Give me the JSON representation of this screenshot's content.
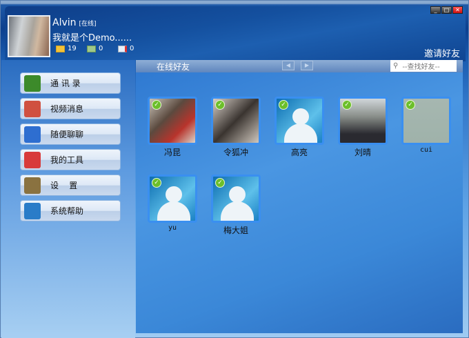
{
  "window": {
    "minimize": "_",
    "restore": "□",
    "close": "✕"
  },
  "profile": {
    "name": "Alvin",
    "status": "[在线]",
    "signature": "我就是个Demo......",
    "mail_count": "19",
    "note_count": "0",
    "message_count": "0"
  },
  "header": {
    "invite": "邀请好友"
  },
  "sidebar": {
    "items": [
      {
        "label": "通 讯 录",
        "icon": "contacts-icon",
        "color": "#3c8a2a"
      },
      {
        "label": "视频消息",
        "icon": "video-message-icon",
        "color": "#d05040"
      },
      {
        "label": "随便聊聊",
        "icon": "chat-icon",
        "color": "#2e6ed0"
      },
      {
        "label": "我的工具",
        "icon": "tools-icon",
        "color": "#d83a3a"
      },
      {
        "label": "设    置",
        "icon": "gear-icon",
        "color": "#8a7240"
      },
      {
        "label": "系统帮助",
        "icon": "help-icon",
        "color": "#2a7cc8"
      }
    ]
  },
  "main": {
    "title": "在线好友",
    "prev": "◀",
    "next": "▶",
    "search_placeholder": "--查找好友--",
    "friends": [
      {
        "name": "冯昆",
        "photo": "linear-gradient(135deg,#c7c2b8,#5b4a3f 40%,#b8342c 70%,#d9d4c9)"
      },
      {
        "name": "令狐冲",
        "photo": "linear-gradient(135deg,#d8d0c8,#3a3430 50%,#cfc7bd)"
      },
      {
        "name": "高亮",
        "photo": ""
      },
      {
        "name": "刘晴",
        "photo": "linear-gradient(180deg,#d0d6da,#8a8f8a 40%,#2a2a30 80%)"
      },
      {
        "name": "cui",
        "photo": "linear-gradient(180deg,#a6b7b0,#9fb2aa)",
        "mono": true
      },
      {
        "name": "yu",
        "photo": "",
        "mono": true
      },
      {
        "name": "梅大姐",
        "photo": ""
      }
    ]
  }
}
